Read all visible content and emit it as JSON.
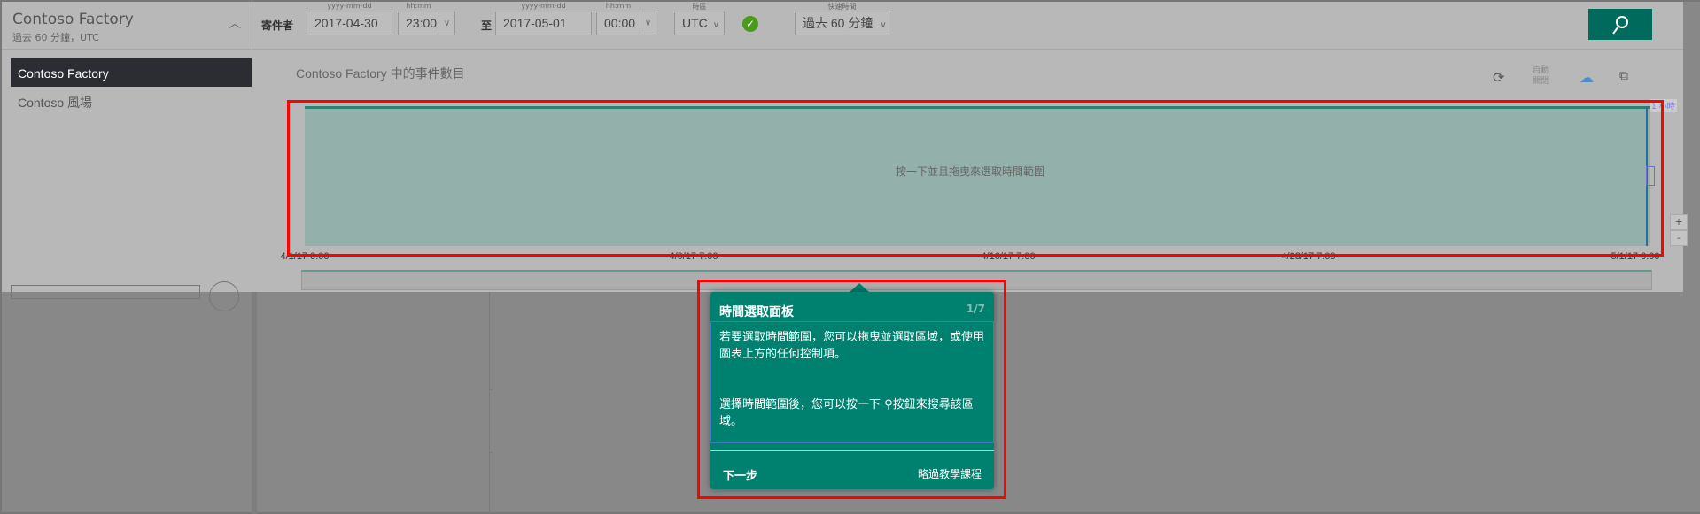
{
  "header": {
    "title": "Contoso Factory",
    "subtitle": "過去 60 分鐘，UTC",
    "from_label": "寄件者",
    "to_label": "至",
    "date_hint": "yyyy-mm-dd",
    "time_hint": "hh:mm",
    "tz_hint": "時區",
    "quick_hint": "快速時間",
    "from_date": "2017-04-30",
    "from_time": "23:00",
    "to_date": "2017-05-01",
    "to_time": "00:00",
    "timezone": "UTC",
    "quick_time": "過去 60 分鐘"
  },
  "sidebar": {
    "items": [
      {
        "label": "Contoso Factory",
        "selected": true
      },
      {
        "label": "Contoso 風場",
        "selected": false
      }
    ]
  },
  "chart": {
    "title": "Contoso Factory 中的事件數目",
    "hint": "按一下並且拖曳來選取時間範圍",
    "auto_off": "自動關閉",
    "interval_label": "1 小時",
    "zoom_in": "+",
    "zoom_out": "-",
    "x_ticks": [
      "4/1/17 0:00",
      "4/9/17 7:00",
      "4/16/17 7:00",
      "4/23/17 7:00",
      "5/1/17 0:00"
    ]
  },
  "tooltip": {
    "title": "時間選取面板",
    "step": "1/7",
    "body1": "若要選取時間範圍，您可以拖曳並選取區域，或使用圖表上方的任何控制項。",
    "body2_pre": "選擇時間範圍後，您可以按一下",
    "body2_post": "按鈕來搜尋該區域。",
    "next": "下一步",
    "skip": "略過教學課程"
  },
  "colors": {
    "accent": "#00806f",
    "search_button": "#006b5c",
    "chart_fill": "#93b0aa",
    "highlight": "#ff0000"
  },
  "icons": [
    "chevron-up-icon",
    "check-circle-icon",
    "search-icon",
    "refresh-icon",
    "cloud-icon",
    "copy-icon"
  ]
}
